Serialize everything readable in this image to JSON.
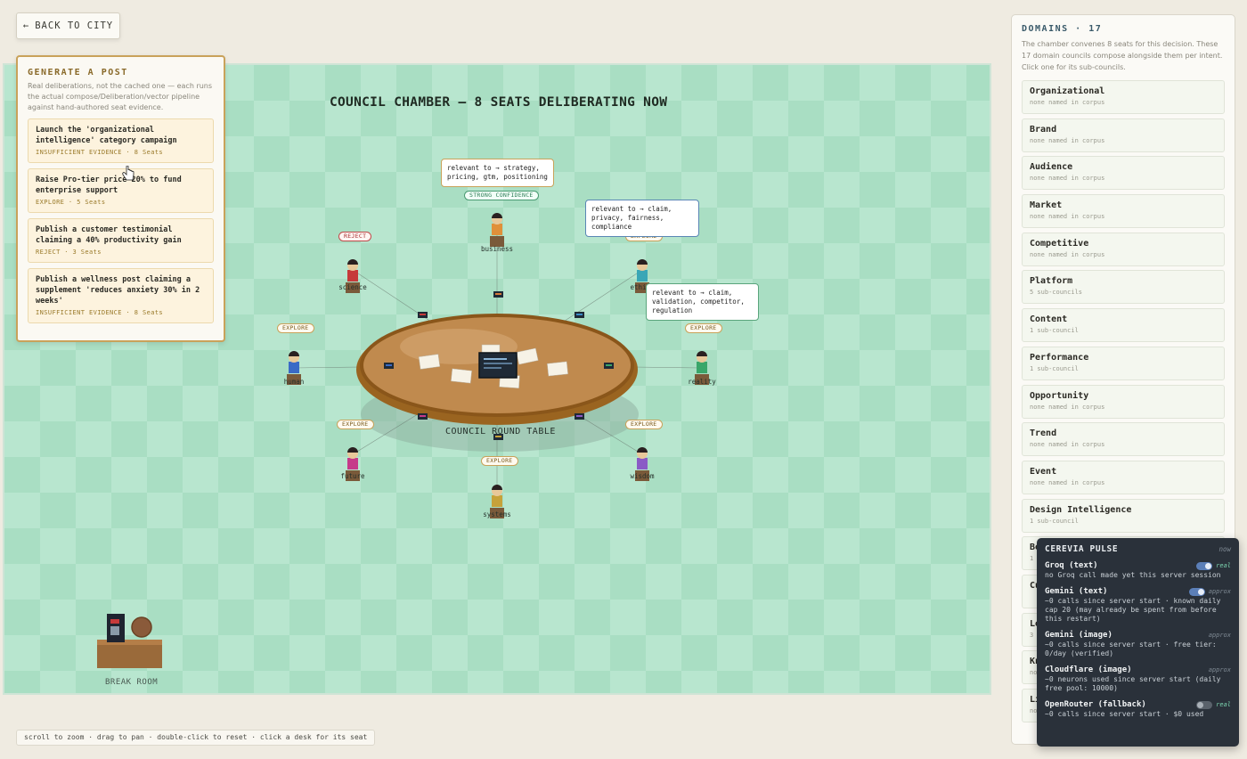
{
  "back_button": {
    "label": "BACK TO CITY",
    "icon": "arrow-left-icon"
  },
  "chamber": {
    "title": "COUNCIL CHAMBER — 8 SEATS DELIBERATING NOW",
    "table_label": "COUNCIL ROUND TABLE",
    "break_room_label": "BREAK ROOM",
    "seats": [
      {
        "name": "business",
        "status": "STRONG CONFIDENCE"
      },
      {
        "name": "ethics",
        "status": "EXPLORE"
      },
      {
        "name": "reality",
        "status": "EXPLORE"
      },
      {
        "name": "wisdom",
        "status": "EXPLORE"
      },
      {
        "name": "systems",
        "status": "EXPLORE"
      },
      {
        "name": "future",
        "status": "EXPLORE"
      },
      {
        "name": "human",
        "status": "EXPLORE"
      },
      {
        "name": "science",
        "status": "REJECT"
      }
    ],
    "bubbles": [
      "relevant to → strategy, pricing, gtm, positioning",
      "relevant to → claim, privacy, fairness, compliance",
      "relevant to → claim, validation, competitor, regulation"
    ]
  },
  "generate_panel": {
    "title": "GENERATE A POST",
    "description": "Real deliberations, not the cached one — each runs the actual compose/Deliberation/vector pipeline against hand-authored seat evidence.",
    "posts": [
      {
        "title": "Launch the 'organizational intelligence' category campaign",
        "meta": "INSUFFICIENT EVIDENCE · 8 Seats"
      },
      {
        "title": "Raise Pro-tier price 20% to fund enterprise support",
        "meta": "EXPLORE · 5 Seats"
      },
      {
        "title": "Publish a customer testimonial claiming a 40% productivity gain",
        "meta": "REJECT · 3 Seats"
      },
      {
        "title": "Publish a wellness post claiming a supplement 'reduces anxiety 30% in 2 weeks'",
        "meta": "INSUFFICIENT EVIDENCE · 8 Seats"
      }
    ]
  },
  "domains_panel": {
    "title": "DOMAINS · 17",
    "description": "The chamber convenes 8 seats for this decision. These 17 domain councils compose alongside them per intent. Click one for its sub-councils.",
    "items": [
      {
        "name": "Organizational",
        "sub": "none named in corpus"
      },
      {
        "name": "Brand",
        "sub": "none named in corpus"
      },
      {
        "name": "Audience",
        "sub": "none named in corpus"
      },
      {
        "name": "Market",
        "sub": "none named in corpus"
      },
      {
        "name": "Competitive",
        "sub": "none named in corpus"
      },
      {
        "name": "Platform",
        "sub": "5 sub-councils"
      },
      {
        "name": "Content",
        "sub": "1 sub-council"
      },
      {
        "name": "Performance",
        "sub": "1 sub-council"
      },
      {
        "name": "Opportunity",
        "sub": "none named in corpus"
      },
      {
        "name": "Trend",
        "sub": "none named in corpus"
      },
      {
        "name": "Event",
        "sub": "none named in corpus"
      },
      {
        "name": "Design Intelligence",
        "sub": "1 sub-council"
      },
      {
        "name": "Bo",
        "sub": "1"
      },
      {
        "name": "Cu",
        "sub": ""
      },
      {
        "name": "Lo",
        "sub": "3"
      },
      {
        "name": "Kn",
        "sub": "no"
      },
      {
        "name": "Li",
        "sub": "no"
      }
    ]
  },
  "pulse": {
    "title": "CEREVIA PULSE",
    "timestamp": "now",
    "providers": [
      {
        "name": "Groq (text)",
        "kind": "real",
        "toggle": true,
        "toggle_on": true,
        "detail": "no Groq call made yet this server session"
      },
      {
        "name": "Gemini (text)",
        "kind": "approx",
        "toggle": true,
        "toggle_on": true,
        "detail": "~0 calls since server start · known daily cap 20 (may already be spent from before this restart)"
      },
      {
        "name": "Gemini (image)",
        "kind": "approx",
        "toggle": false,
        "toggle_on": false,
        "detail": "~0 calls since server start · free tier: 0/day (verified)"
      },
      {
        "name": "Cloudflare (image)",
        "kind": "approx",
        "toggle": false,
        "toggle_on": false,
        "detail": "~0 neurons used since server start (daily free pool: 10000)"
      },
      {
        "name": "OpenRouter (fallback)",
        "kind": "real",
        "toggle": true,
        "toggle_on": false,
        "detail": "~0 calls since server start · $0 used"
      }
    ]
  },
  "hint": "scroll to zoom · drag to pan · double-click to reset · click a desk for its seat",
  "colors": {
    "map_bg": "#b8e6cf",
    "accent_gold": "#c9a25a",
    "pulse_bg": "#2a313a"
  }
}
